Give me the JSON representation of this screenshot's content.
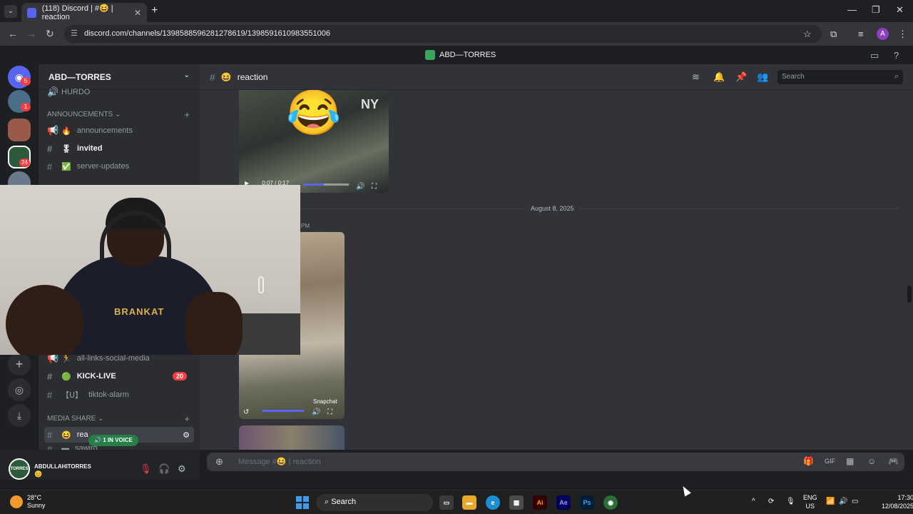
{
  "browser": {
    "tab_title": "(118) Discord | #😆 | reaction",
    "tab_count_badge": "118",
    "url": "discord.com/channels/1398588596281278619/1398591610983551006"
  },
  "top_title": "ABD—TORRES",
  "guild_badges": [
    "5",
    "1",
    "24"
  ],
  "server": {
    "name": "ABD—TORRES",
    "channels": [
      {
        "hash": "🔊",
        "emoji": "",
        "label": "HURDO",
        "bold": false
      },
      {
        "category": "ANNOUNCEMENTS"
      },
      {
        "hash": "📢",
        "emoji": "🔥",
        "label": "announcements",
        "bold": false
      },
      {
        "hash": "#",
        "emoji": "🎖",
        "label": "invited",
        "bold": true
      },
      {
        "hash": "#",
        "emoji": "✅",
        "label": "server-updates",
        "bold": false
      },
      {
        "hash": "📢",
        "emoji": "🏃",
        "label": "all-links-social-media",
        "bold": false
      },
      {
        "hash": "#",
        "emoji": "🟢",
        "label": "KICK-LIVE",
        "bold": true,
        "count": "20"
      },
      {
        "hash": "#",
        "emoji": "【ᑌ】",
        "label": "tiktok-alarm",
        "bold": false
      },
      {
        "category": "MEDIA SHARE"
      },
      {
        "hash": "#",
        "emoji": "😆",
        "label": "rea",
        "bold": true,
        "active": true
      },
      {
        "hash": "#",
        "emoji": "▬",
        "label": "sawiro",
        "bold": false
      }
    ],
    "voice_pill": "1 IN VOICE"
  },
  "user": {
    "avatar_text": "TORRES",
    "name": "ABDULLAHITORRES",
    "status": "😊"
  },
  "chat": {
    "channel_name": "reaction",
    "channel_emoji": "😆",
    "search_placeholder": "Search",
    "video1_time": "0:07 / 0:17",
    "video1_logo": "NY",
    "video1_emoji": "😂",
    "date_divider": "August 8, 2025",
    "partial_time": "PM",
    "video2_caption": "Snapchat",
    "composer_placeholder": "Message #😆 | reaction"
  },
  "webcam": {
    "shirt_text": "BRANKAT"
  },
  "taskbar": {
    "temp": "28°C",
    "condition": "Sunny",
    "search": "Search",
    "lang_top": "ENG",
    "lang_bottom": "US",
    "time": "17:30",
    "date": "12/08/2025",
    "apps": [
      {
        "name": "illustrator",
        "label": "Ai",
        "color": "#330000",
        "fg": "#ff9a00"
      },
      {
        "name": "after-effects",
        "label": "Ae",
        "color": "#00005b",
        "fg": "#9999ff"
      },
      {
        "name": "photoshop",
        "label": "Ps",
        "color": "#001e36",
        "fg": "#31a8ff"
      }
    ]
  }
}
